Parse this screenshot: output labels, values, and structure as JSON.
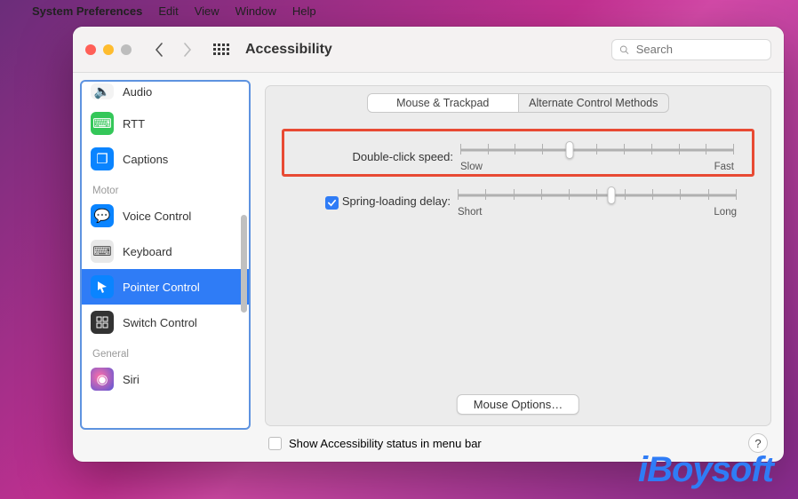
{
  "menubar": {
    "app": "System Preferences",
    "items": [
      "Edit",
      "View",
      "Window",
      "Help"
    ]
  },
  "window": {
    "title": "Accessibility",
    "search_placeholder": "Search"
  },
  "sidebar": {
    "categories": [
      {
        "label": "",
        "items": [
          {
            "name": "audio",
            "label": "Audio",
            "icon_bg": "#f0f0f0",
            "glyph": "🔊"
          },
          {
            "name": "rtt",
            "label": "RTT",
            "icon_bg": "#34c759",
            "glyph": "⌨"
          },
          {
            "name": "captions",
            "label": "Captions",
            "icon_bg": "#0a84ff",
            "glyph": "❐"
          }
        ]
      },
      {
        "label": "Motor",
        "items": [
          {
            "name": "voice-control",
            "label": "Voice Control",
            "icon_bg": "#0a84ff",
            "glyph": "💬"
          },
          {
            "name": "keyboard",
            "label": "Keyboard",
            "icon_bg": "#9e9e9e",
            "glyph": "⌨"
          },
          {
            "name": "pointer-control",
            "label": "Pointer Control",
            "icon_bg": "#0a84ff",
            "glyph": "➤",
            "selected": true
          },
          {
            "name": "switch-control",
            "label": "Switch Control",
            "icon_bg": "#333333",
            "glyph": "⊞"
          }
        ]
      },
      {
        "label": "General",
        "items": [
          {
            "name": "siri",
            "label": "Siri",
            "icon_bg": "linear-gradient(135deg,#5856d6,#ff2d55)",
            "glyph": "◉"
          }
        ]
      }
    ]
  },
  "panel": {
    "tabs": {
      "active": "Mouse & Trackpad",
      "other": "Alternate Control Methods"
    },
    "double_click": {
      "label": "Double-click speed:",
      "low": "Slow",
      "high": "Fast",
      "value_pct": 40,
      "ticks": 11
    },
    "spring_loading": {
      "label": "Spring-loading delay:",
      "low": "Short",
      "high": "Long",
      "checked": true,
      "value_pct": 55,
      "ticks": 11
    },
    "mouse_options": "Mouse Options…"
  },
  "footer": {
    "checkbox_label": "Show Accessibility status in menu bar"
  },
  "watermark": "iBoysoft"
}
